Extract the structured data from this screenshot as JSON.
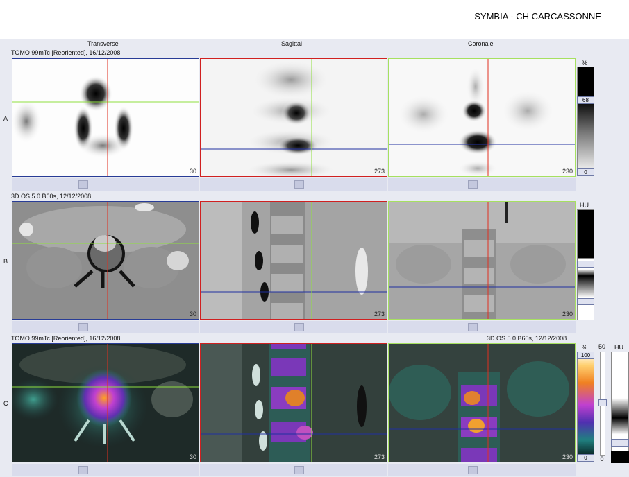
{
  "app": {
    "title": "SYMBIA - CH CARCASSONNE"
  },
  "views": {
    "transverse": "Transverse",
    "sagittal": "Sagittal",
    "coronal": "Coronale"
  },
  "rows": [
    {
      "letter": "A",
      "series": "TOMO 99mTc [Reoriented], 16/12/2008",
      "unit": "%",
      "scale_max": "68",
      "scale_min": "0",
      "slices": {
        "transverse": "30",
        "sagittal": "273",
        "coronal": "230"
      }
    },
    {
      "letter": "B",
      "series": "3D  OS  5.0  B60s, 12/12/2008",
      "unit": "HU",
      "slices": {
        "transverse": "30",
        "sagittal": "273",
        "coronal": "230"
      }
    },
    {
      "letter": "C",
      "series": "TOMO 99mTc [Reoriented], 16/12/2008",
      "series_right": "3D  OS  5.0  B60s, 12/12/2008",
      "unit": "%",
      "unit_right": "HU",
      "scale_max": "100",
      "scale_min": "0",
      "blend_value": "50",
      "blend_min": "0",
      "slices": {
        "transverse": "30",
        "sagittal": "273",
        "coronal": "230"
      }
    }
  ],
  "colors": {
    "transverse_border": "#283c96",
    "sagittal_border": "#d02020",
    "coronal_border": "#a6e060",
    "crosshair_red": "#e03020",
    "crosshair_green": "#90e040",
    "crosshair_blue": "#2030a0"
  }
}
